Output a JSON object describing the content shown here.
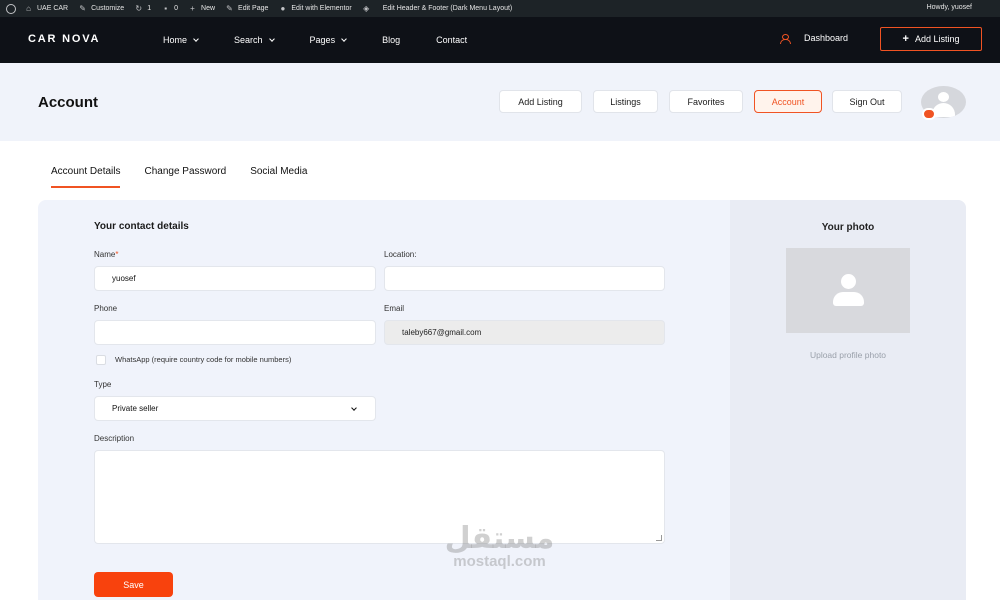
{
  "admin_bar": {
    "site": "UAE CAR",
    "customize": "Customize",
    "updates": "1",
    "comments": "0",
    "new": "New",
    "edit_page": "Edit Page",
    "elementor": "Edit with Elementor",
    "header_footer": "Edit Header & Footer (Dark Menu Layout)",
    "howdy": "Howdy, yuosef"
  },
  "nav": {
    "logo": "CAR NOVA",
    "links": [
      "Home",
      "Search",
      "Pages",
      "Blog",
      "Contact"
    ],
    "dashboard": "Dashboard",
    "add_listing": "Add Listing"
  },
  "header": {
    "title": "Account",
    "buttons": [
      "Add Listing",
      "Listings",
      "Favorites",
      "Account",
      "Sign Out"
    ],
    "active": "Account"
  },
  "tabs": {
    "items": [
      "Account Details",
      "Change Password",
      "Social Media"
    ],
    "active": "Account Details"
  },
  "form": {
    "section_title": "Your contact details",
    "name_label": "Name",
    "name_required": "*",
    "name_value": "yuosef",
    "location_label": "Location:",
    "location_value": "",
    "phone_label": "Phone",
    "phone_value": "",
    "email_label": "Email",
    "email_value": "taleby667@gmail.com",
    "whatsapp_label": "WhatsApp (require country code for mobile numbers)",
    "whatsapp_checked": false,
    "type_label": "Type",
    "type_value": "Private seller",
    "description_label": "Description",
    "description_value": "",
    "save_label": "Save"
  },
  "photo": {
    "title": "Your photo",
    "upload_label": "Upload profile photo"
  },
  "watermark": {
    "arabic": "مستقل",
    "latin": "mostaql.com"
  },
  "colors": {
    "accent": "#f05323",
    "nav_bg": "#0e1117",
    "admin_bg": "#1d2327",
    "panel_bg": "#f0f3fb"
  }
}
